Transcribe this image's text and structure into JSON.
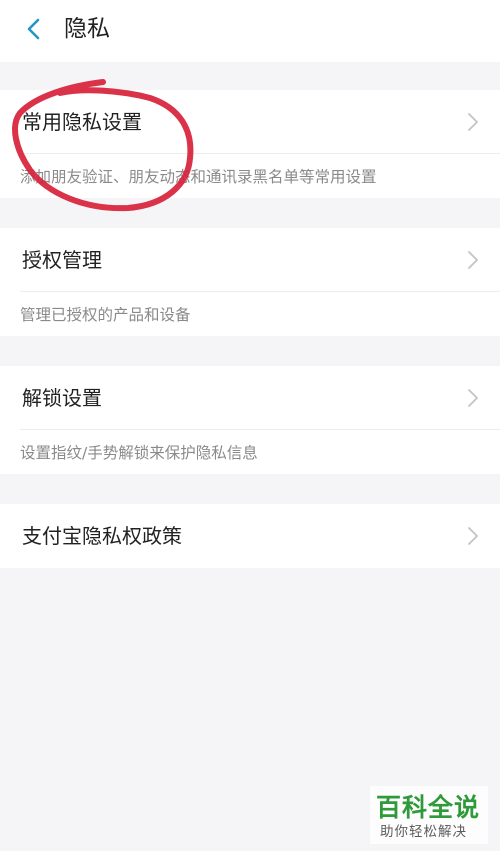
{
  "header": {
    "title": "隐私",
    "back_icon": "chevron-left-icon",
    "accent_color": "#2196c8"
  },
  "groups": [
    {
      "label": "常用隐私设置",
      "description": "添加朋友验证、朋友动态和通讯录黑名单等常用设置"
    },
    {
      "label": "授权管理",
      "description": "管理已授权的产品和设备"
    },
    {
      "label": "解锁设置",
      "description": "设置指纹/手势解锁来保护隐私信息"
    },
    {
      "label": "支付宝隐私权政策"
    }
  ],
  "annotation": {
    "color": "#d6213a"
  },
  "watermark": {
    "main": "百科全说",
    "sub": "助你轻松解决"
  }
}
